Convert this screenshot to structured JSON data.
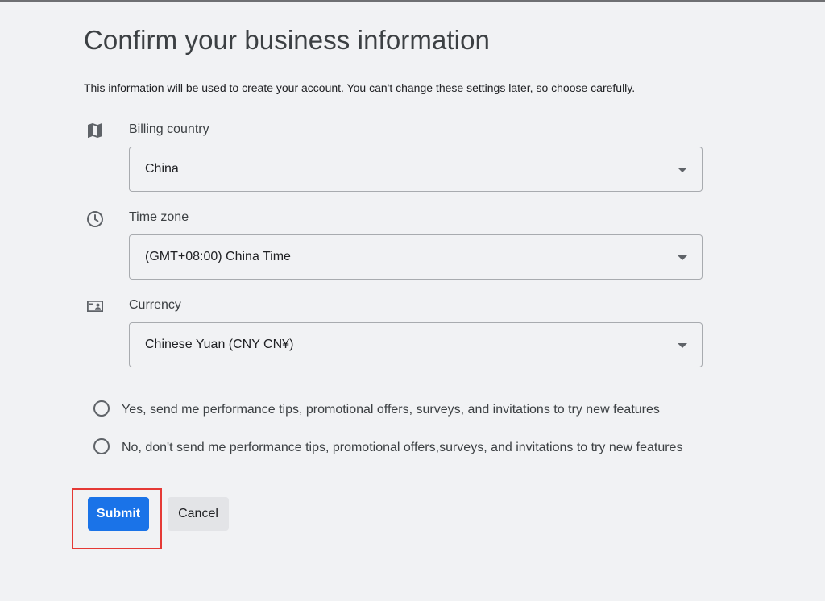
{
  "page": {
    "title": "Confirm your business information",
    "subtitle": "This information will be used to create your account. You can't change these settings later, so choose carefully."
  },
  "fields": {
    "billing_country": {
      "label": "Billing country",
      "value": "China",
      "icon": "map-icon"
    },
    "time_zone": {
      "label": "Time zone",
      "value": "(GMT+08:00) China Time",
      "icon": "clock-icon"
    },
    "currency": {
      "label": "Currency",
      "value": "Chinese Yuan (CNY CN¥)",
      "icon": "money-icon"
    }
  },
  "marketing": {
    "options": [
      {
        "label": "Yes, send me performance tips, promotional offers, surveys, and invitations to try new features",
        "selected": false
      },
      {
        "label": "No, don't send me performance tips, promotional offers,surveys, and invitations to try new features",
        "selected": false
      }
    ]
  },
  "actions": {
    "submit_label": "Submit",
    "cancel_label": "Cancel"
  },
  "colors": {
    "primary": "#1a73e8",
    "highlight": "#e53935",
    "background": "#f1f2f4"
  }
}
